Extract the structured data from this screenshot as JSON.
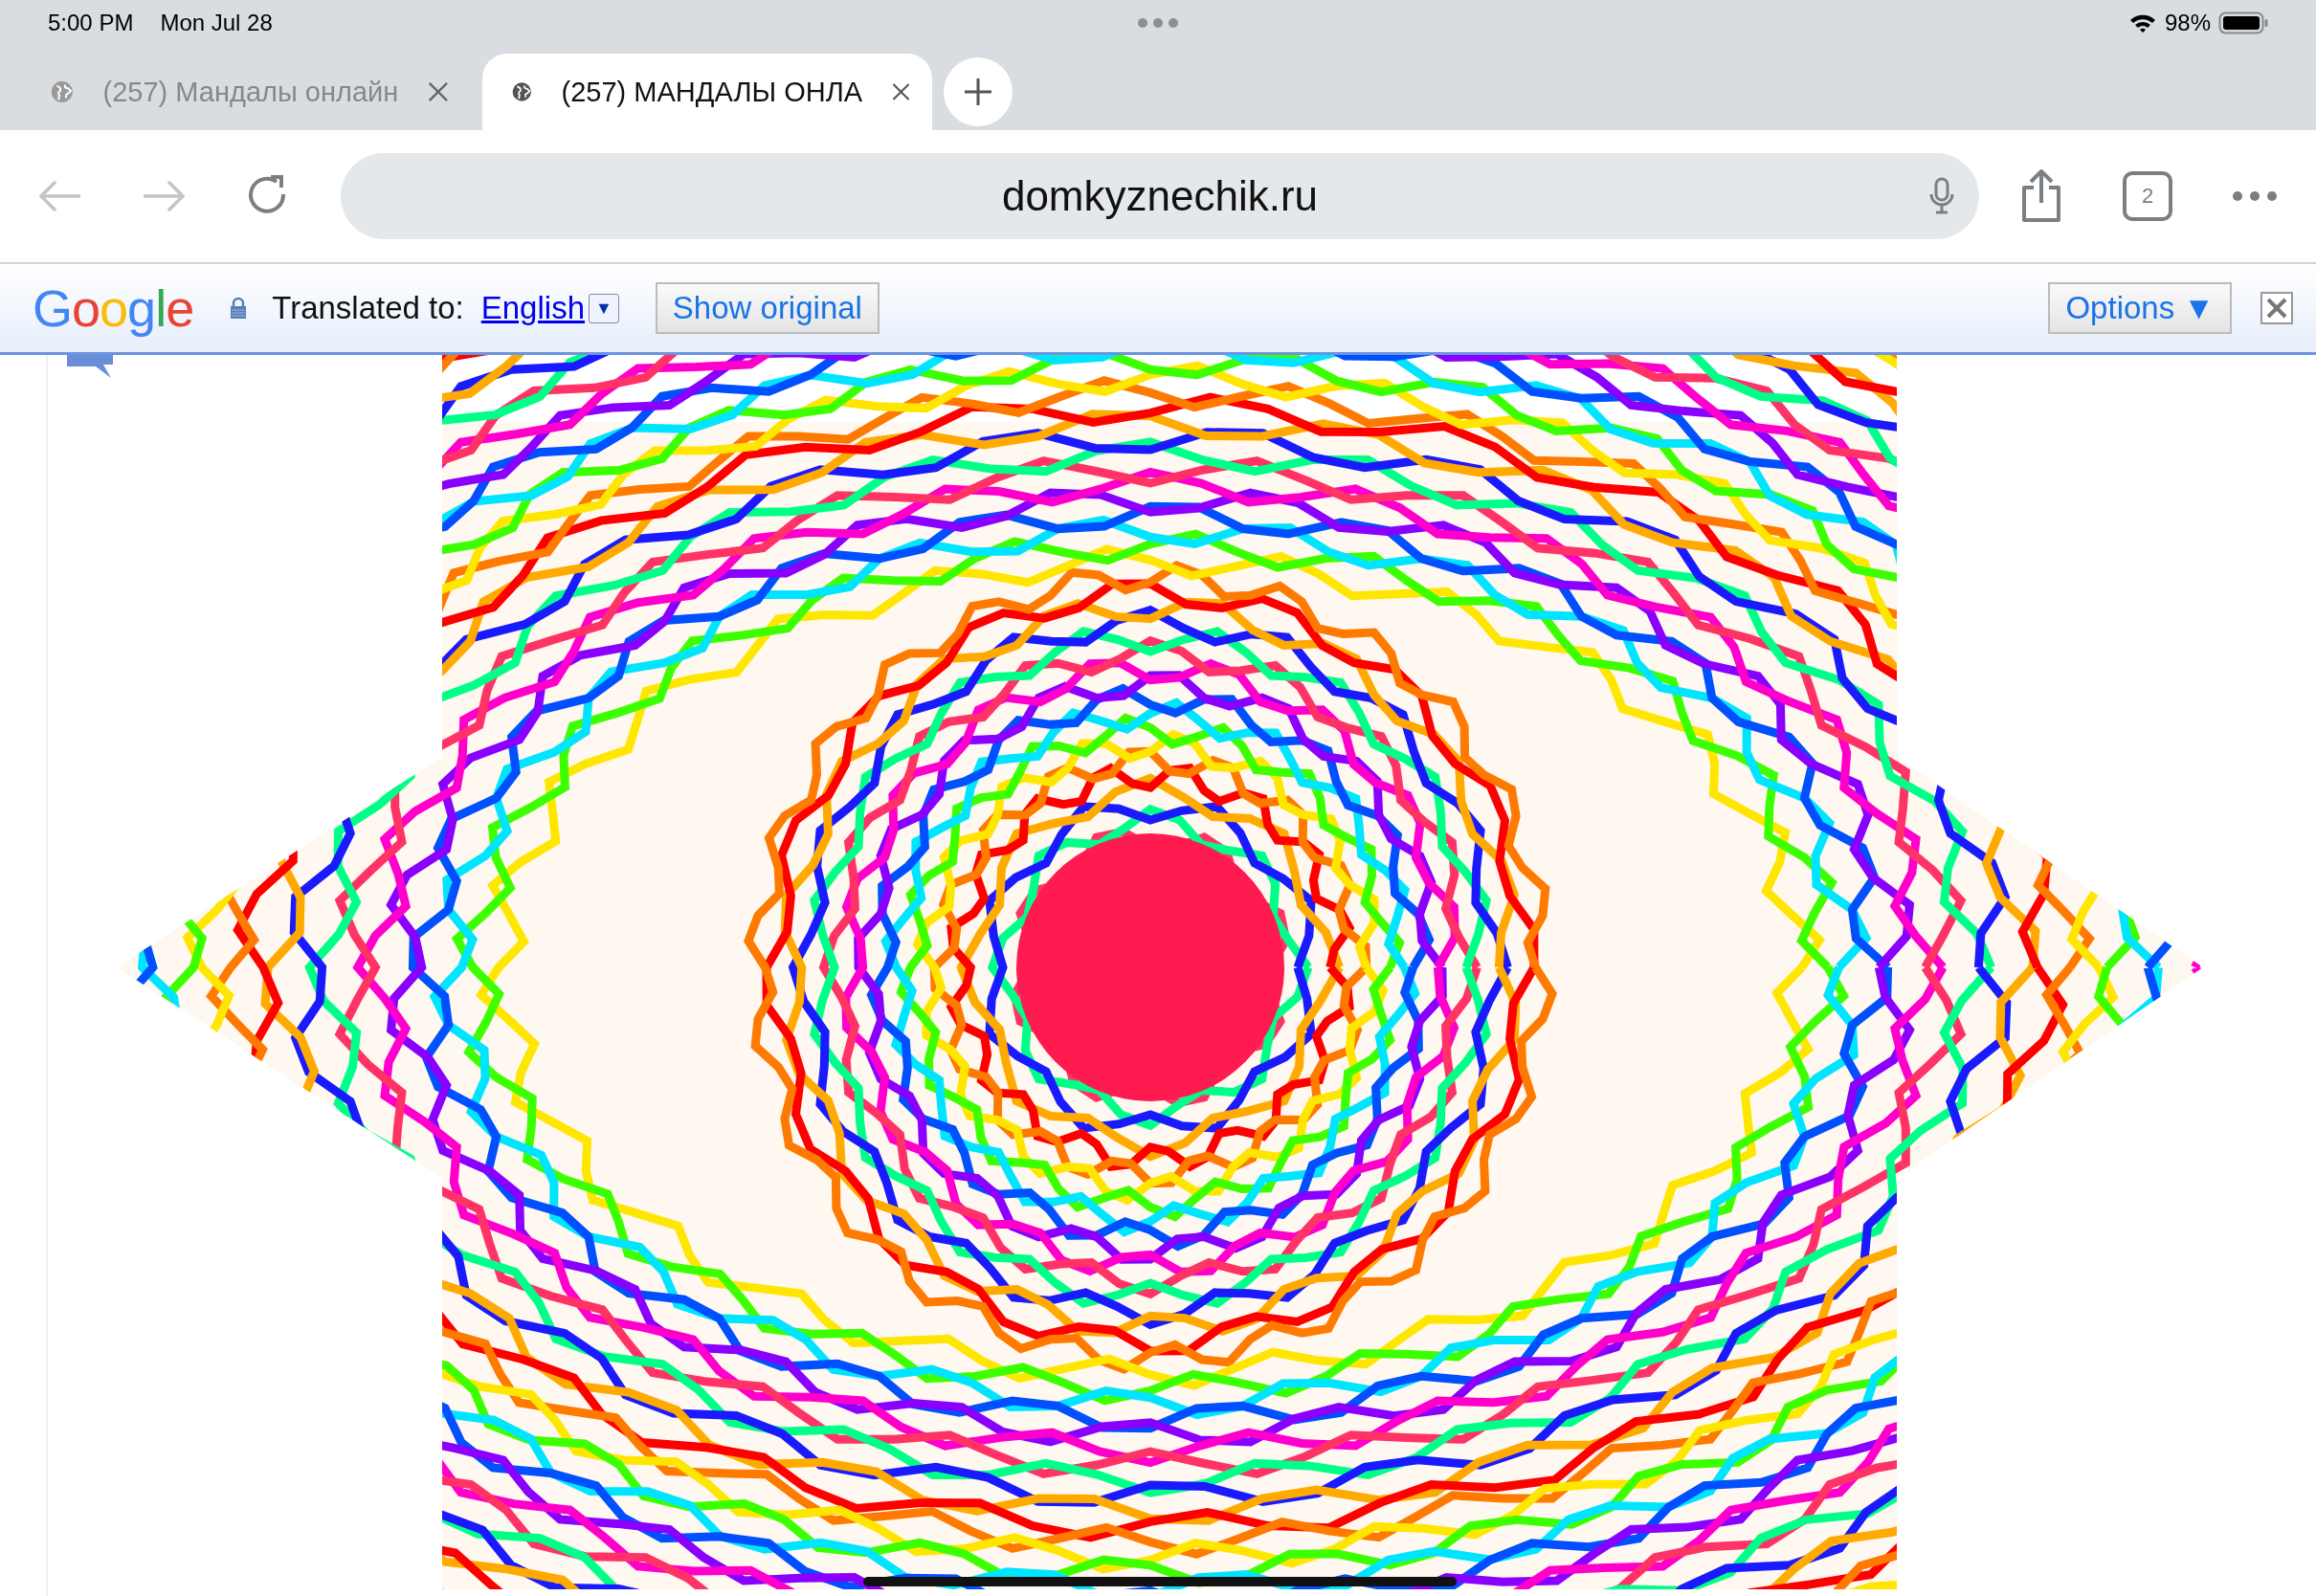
{
  "status_bar": {
    "time": "5:00 PM",
    "date": "Mon Jul 28",
    "battery": "98%"
  },
  "tabs": [
    {
      "label": "(257) Мандалы онлайн",
      "selected": false
    },
    {
      "label": "(257) МАНДАЛЫ ОНЛА",
      "selected": true
    }
  ],
  "toolbar": {
    "url": "domkyznechik.ru",
    "tab_count": "2"
  },
  "translate_bar": {
    "logo": "Google",
    "label": "Translated to:",
    "language": "English",
    "dropdown": "▼",
    "show_original": "Show original",
    "options": "Options ▼"
  }
}
